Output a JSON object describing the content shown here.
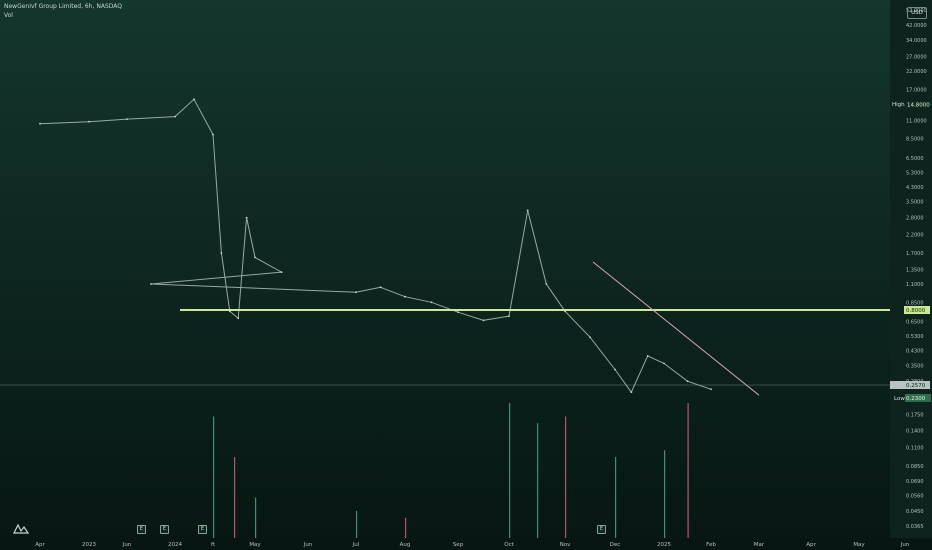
{
  "header": {
    "symbol": "NewGenIvf Group Limited, 6h, NASDAQ",
    "sub": "Vol"
  },
  "currency_button": "USD",
  "events": [
    {
      "label": "E",
      "month": "Nov 2023"
    },
    {
      "label": "E",
      "month": "Dec 2023"
    },
    {
      "label": "E",
      "month": "Jan 2024"
    },
    {
      "label": "E",
      "month": "Nov 2024"
    }
  ],
  "chart_data": {
    "type": "line",
    "scale": "log",
    "x_ticks": [
      "Apr",
      "2023",
      "Jun",
      "2024",
      "ft",
      "May",
      "Jun",
      "Jul",
      "Aug",
      "Sep",
      "Oct",
      "Nov",
      "Dec",
      "2025",
      "Feb",
      "Mar",
      "Apr",
      "May",
      "Jun"
    ],
    "y_ticks": [
      "52.0000",
      "42.0000",
      "34.0000",
      "27.0000",
      "22.0000",
      "17.0000",
      "13.5000",
      "11.0000",
      "8.5000",
      "6.5000",
      "5.3000",
      "4.3000",
      "3.5000",
      "2.8000",
      "2.2000",
      "1.7000",
      "1.3500",
      "1.1000",
      "0.8500",
      "0.6500",
      "0.5300",
      "0.4300",
      "0.3500",
      "0.2800",
      "0.2250",
      "0.1750",
      "0.1400",
      "0.1100",
      "0.0850",
      "0.0690",
      "0.0560",
      "0.0450",
      "0.0365"
    ],
    "high_label": "High",
    "high_value": "14.8000",
    "low_label": "Low",
    "low_value": "0.2300",
    "current_value": "0.2570",
    "support_level": "0.8000",
    "price_series": {
      "name": "Price",
      "color": "#9aa8a4",
      "points": [
        [
          "Apr",
          10.5
        ],
        [
          "2023",
          10.8
        ],
        [
          "Jun",
          11.2
        ],
        [
          "2024",
          11.6
        ],
        [
          "2024",
          14.8
        ],
        [
          "ft",
          9.0
        ],
        [
          "ft",
          1.7
        ],
        [
          "ft",
          0.75
        ],
        [
          "ft",
          0.68
        ],
        [
          "ft",
          2.8
        ],
        [
          "May",
          1.6
        ],
        [
          "May",
          1.3
        ],
        [
          "Jun",
          1.1
        ],
        [
          "Jul",
          0.98
        ],
        [
          "Jul",
          1.05
        ],
        [
          "Aug",
          0.92
        ],
        [
          "Aug",
          0.85
        ],
        [
          "Sep",
          0.74
        ],
        [
          "Sep",
          0.66
        ],
        [
          "Oct",
          0.7
        ],
        [
          "Oct",
          3.1
        ],
        [
          "Oct",
          1.1
        ],
        [
          "Nov",
          0.75
        ],
        [
          "Nov",
          0.52
        ],
        [
          "Dec",
          0.33
        ],
        [
          "Dec",
          0.24
        ],
        [
          "Dec",
          0.4
        ],
        [
          "2025",
          0.36
        ],
        [
          "2025",
          0.28
        ],
        [
          "Feb",
          0.25
        ]
      ]
    },
    "trendline": {
      "start": [
        "Nov",
        1.5
      ],
      "end": [
        "Mar",
        0.23
      ],
      "color": "#d7a6b3"
    },
    "volume_series": {
      "name": "Vol",
      "color_up": "#3f8f7f",
      "color_down": "#b5566a",
      "spikes": [
        [
          "ft",
          0.9
        ],
        [
          "ft",
          0.6
        ],
        [
          "May",
          0.3
        ],
        [
          "Jul",
          0.2
        ],
        [
          "Aug",
          0.15
        ],
        [
          "Oct",
          1.0
        ],
        [
          "Oct",
          0.85
        ],
        [
          "Nov",
          0.9
        ],
        [
          "Dec",
          0.6
        ],
        [
          "2025",
          0.65
        ],
        [
          "2025",
          1.0
        ]
      ]
    },
    "grid": false,
    "legend": "none"
  }
}
